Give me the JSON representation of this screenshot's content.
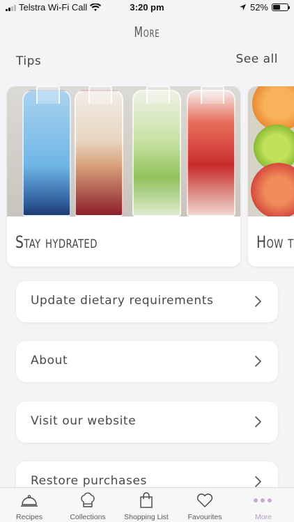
{
  "status": {
    "carrier": "Telstra Wi-Fi Call",
    "time": "3:20 pm",
    "battery": "52%",
    "battery_level": 0.52
  },
  "header": {
    "title": "More"
  },
  "tips": {
    "label": "Tips",
    "see_all": "See all",
    "cards": [
      {
        "title": "Stay hydrated"
      },
      {
        "title": "How to"
      }
    ]
  },
  "menu": {
    "items": [
      {
        "label": "Update dietary requirements"
      },
      {
        "label": "About"
      },
      {
        "label": "Visit our website"
      },
      {
        "label": "Restore purchases"
      }
    ]
  },
  "tabbar": {
    "tabs": [
      {
        "label": "Recipes",
        "icon": "cloche-icon"
      },
      {
        "label": "Collections",
        "icon": "chef-hat-icon"
      },
      {
        "label": "Shopping List",
        "icon": "shopping-bag-icon"
      },
      {
        "label": "Favourites",
        "icon": "heart-icon"
      },
      {
        "label": "More",
        "icon": "more-dots-icon",
        "active": true
      }
    ],
    "active_color": "#b894c9"
  }
}
